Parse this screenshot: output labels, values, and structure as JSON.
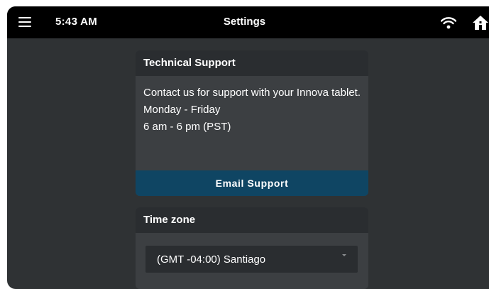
{
  "status_bar": {
    "time": "5:43 AM",
    "title": "Settings"
  },
  "icons": {
    "menu": "hamburger-menu-icon",
    "wifi": "wifi-icon",
    "home": "home-icon"
  },
  "colors": {
    "background": "#2f3234",
    "topbar": "#000000",
    "card_header": "#2a2d30",
    "card_body": "#3c3f42",
    "email_button": "#0f4563",
    "text": "#ffffff"
  },
  "technical_support": {
    "heading": "Technical Support",
    "description": "Contact us for support with your Innova tablet.",
    "days": "Monday - Friday",
    "hours": "6 am - 6 pm (PST)",
    "button_label": "Email Support"
  },
  "time_zone": {
    "heading": "Time zone",
    "selected": "(GMT -04:00) Santiago"
  }
}
